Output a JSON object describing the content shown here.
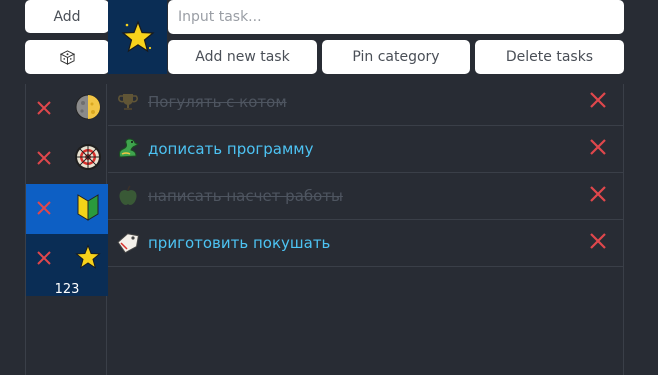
{
  "toolbar": {
    "add_label": "Add",
    "add_new_task_label": "Add new task",
    "pin_category_label": "Pin category",
    "delete_tasks_label": "Delete tasks"
  },
  "input": {
    "placeholder": "Input task...",
    "value": ""
  },
  "selected_category_icon": "star-icon",
  "categories": [
    {
      "icon": "moon-icon",
      "selected": false
    },
    {
      "icon": "dartboard-icon",
      "selected": false
    },
    {
      "icon": "beginner-badge-icon",
      "selected": true
    },
    {
      "icon": "star-icon",
      "selected": false,
      "count": "123"
    }
  ],
  "tasks": [
    {
      "label": "Погулять с котом",
      "icon": "trophy-icon",
      "done": true
    },
    {
      "label": "дописать программу",
      "icon": "dragon-icon",
      "done": false
    },
    {
      "label": "написать насчет работы",
      "icon": "apple-icon",
      "done": true
    },
    {
      "label": "приготовить покушать",
      "icon": "label-tag-icon",
      "done": false
    }
  ],
  "colors": {
    "background": "#282c34",
    "accent_blue": "#0d5fc4",
    "dark_blue": "#0a2d55",
    "task_text": "#4dc3f3",
    "delete_red": "#e0474c"
  }
}
